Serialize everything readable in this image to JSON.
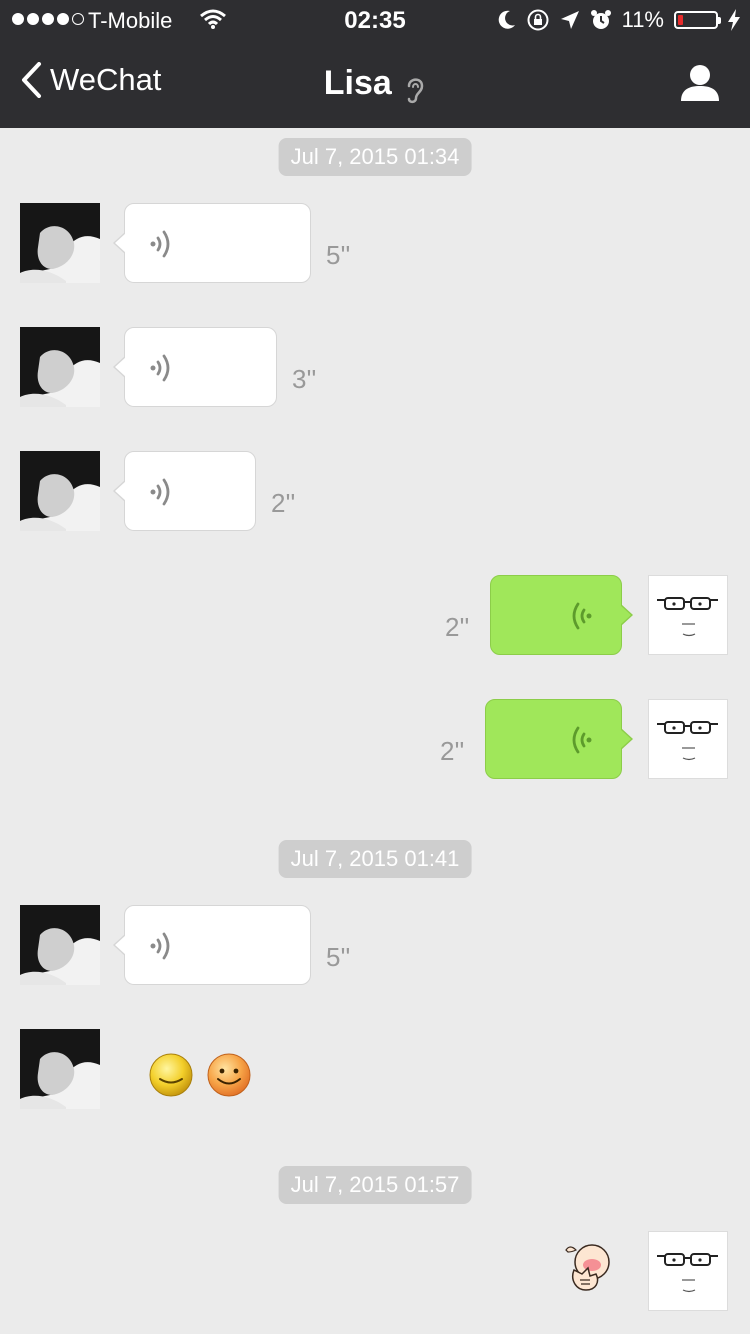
{
  "status_bar": {
    "carrier": "T-Mobile",
    "time": "02:35",
    "battery": "11%",
    "battery_level": 0.11,
    "icons": [
      "signal-dots",
      "wifi-icon",
      "moon-icon",
      "rotation-lock-icon",
      "location-arrow-icon",
      "alarm-icon",
      "battery-icon",
      "charging-bolt-icon"
    ]
  },
  "nav": {
    "back_label": "WeChat",
    "title": "Lisa",
    "title_icon": "ear-icon",
    "right_icon": "profile-icon"
  },
  "chat": {
    "timestamps": [
      "Jul 7, 2015 01:34",
      "Jul 7, 2015 01:41",
      "Jul 7, 2015 01:57"
    ],
    "messages": [
      {
        "sender": "Lisa",
        "type": "voice",
        "duration": "5''"
      },
      {
        "sender": "Lisa",
        "type": "voice",
        "duration": "3''"
      },
      {
        "sender": "Lisa",
        "type": "voice",
        "duration": "2''"
      },
      {
        "sender": "me",
        "type": "voice",
        "duration": "2''"
      },
      {
        "sender": "me",
        "type": "voice",
        "duration": "2''"
      },
      {
        "sender": "Lisa",
        "type": "voice",
        "duration": "5''"
      },
      {
        "sender": "Lisa",
        "type": "emoji",
        "icons": [
          "smile-emoji-icon",
          "grin-emoji-icon"
        ]
      },
      {
        "sender": "me",
        "type": "sticker",
        "icon": "blushing-sticker-icon"
      }
    ]
  },
  "colors": {
    "nav_bg": "#2e2e31",
    "chat_bg": "#ebebeb",
    "outgoing_bubble": "#a0e75a",
    "incoming_bubble": "#ffffff",
    "timestamp_bg": "#cecece",
    "duration_text": "#999999"
  }
}
